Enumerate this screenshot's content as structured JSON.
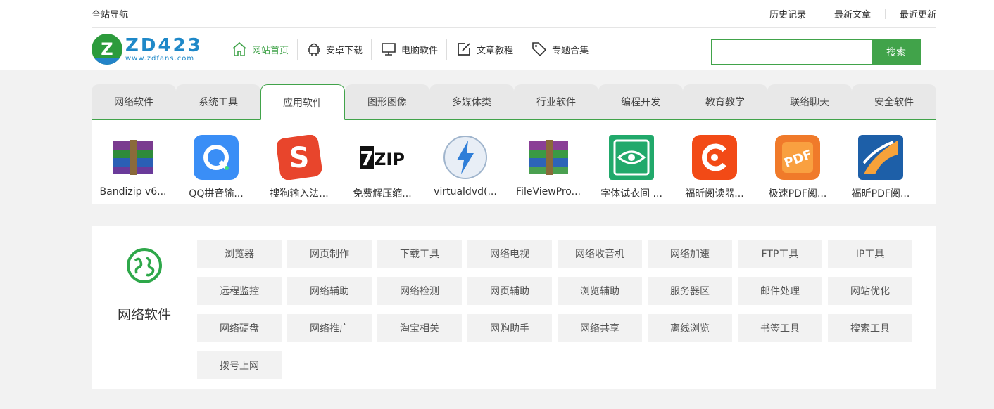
{
  "topbar": {
    "left": "全站导航",
    "links": [
      "历史记录",
      "最新文章",
      "最近更新"
    ]
  },
  "logo": {
    "mark": "Z",
    "big": "ZD423",
    "small": "www.zdfans.com"
  },
  "nav": [
    {
      "label": "网站首页",
      "icon": "home-icon",
      "active": true
    },
    {
      "label": "安卓下载",
      "icon": "android-icon",
      "active": false
    },
    {
      "label": "电脑软件",
      "icon": "monitor-icon",
      "active": false
    },
    {
      "label": "文章教程",
      "icon": "edit-icon",
      "active": false
    },
    {
      "label": "专题合集",
      "icon": "tag-icon",
      "active": false
    }
  ],
  "search": {
    "value": "",
    "button": "搜索"
  },
  "colors": {
    "accent": "#41a34a",
    "brand": "#1e88c8"
  },
  "tabs": [
    "网络软件",
    "系统工具",
    "应用软件",
    "图形图像",
    "多媒体类",
    "行业软件",
    "编程开发",
    "教育教学",
    "联络聊天",
    "安全软件"
  ],
  "active_tab": 2,
  "apps": [
    {
      "name": "Bandizip v6...",
      "icon": "winrar-books-icon"
    },
    {
      "name": "QQ拼音输...",
      "icon": "qq-pinyin-icon"
    },
    {
      "name": "搜狗输入法...",
      "icon": "sogou-icon"
    },
    {
      "name": "免费解压缩...",
      "icon": "7zip-icon",
      "text": "7ZIP"
    },
    {
      "name": "virtualdvd(...",
      "icon": "daemon-lightning-icon"
    },
    {
      "name": "FileViewPro...",
      "icon": "books-stack-icon"
    },
    {
      "name": "字体试衣间 ...",
      "icon": "eye-frame-icon"
    },
    {
      "name": "福昕阅读器...",
      "icon": "foxit-icon"
    },
    {
      "name": "极速PDF阅...",
      "icon": "pdf-icon",
      "text": "PDF"
    },
    {
      "name": "福昕PDF阅...",
      "icon": "foxit-pdf-icon"
    }
  ],
  "category": {
    "title": "网络软件",
    "icon": "globe-icon",
    "items": [
      "浏览器",
      "网页制作",
      "下载工具",
      "网络电视",
      "网络收音机",
      "网络加速",
      "FTP工具",
      "IP工具",
      "远程监控",
      "网络辅助",
      "网络检测",
      "网页辅助",
      "浏览辅助",
      "服务器区",
      "邮件处理",
      "网站优化",
      "网络硬盘",
      "网络推广",
      "淘宝相关",
      "网购助手",
      "网络共享",
      "离线浏览",
      "书签工具",
      "搜索工具",
      "拨号上网"
    ]
  }
}
